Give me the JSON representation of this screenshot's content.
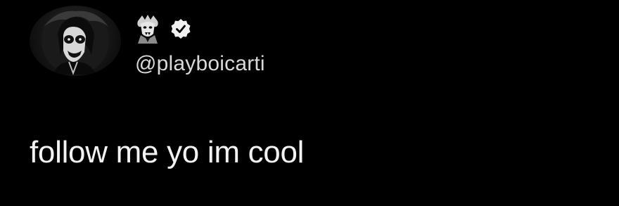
{
  "tweet": {
    "handle": "@playboicarti",
    "text": "follow me yo im cool",
    "avatar_icon": "vampire-face-avatar",
    "display_name_icon": "vampire-emoji-icon",
    "verified_icon": "verified-badge-icon"
  },
  "colors": {
    "background": "#000000",
    "text": "#f2f2f2",
    "handle": "#d9d9d9"
  }
}
